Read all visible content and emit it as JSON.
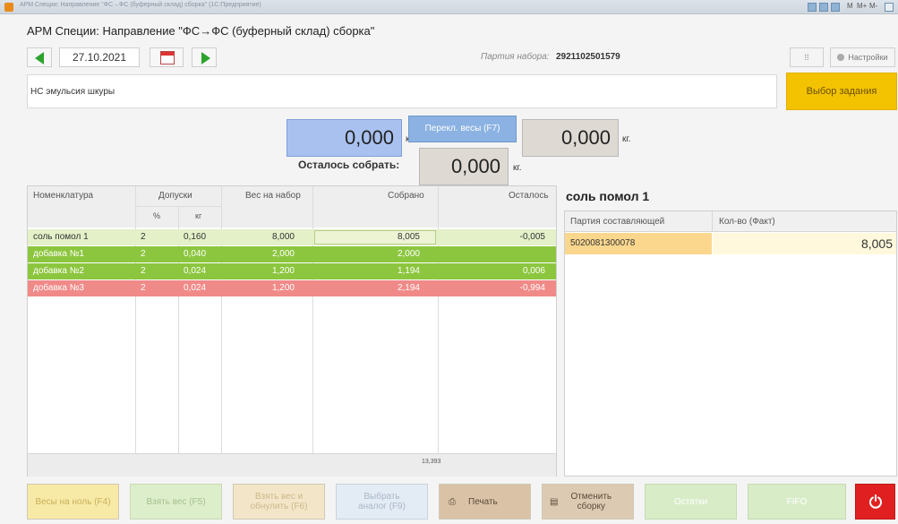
{
  "window": {
    "title_bar_text": "АРМ Специи: Направление \"ФС→ФС (буферный склад) сборка\" (1С:Предприятие)"
  },
  "page_title": "АРМ Специи: Направление \"ФС→ФС (буферный склад) сборка\"",
  "toolbar": {
    "date": "27.10.2021",
    "party_label": "Партия набора:",
    "party_value": "2921102501579",
    "settings_label": "Настройки"
  },
  "task": {
    "current": "НС эмульсия шкуры",
    "select_button": "Выбор задания"
  },
  "scales": {
    "left_value": "0,000",
    "left_unit": "кг.",
    "switch_button": "Перекл. весы (F7)",
    "right_value": "0,000",
    "right_unit": "кг.",
    "remaining_label": "Осталось собрать:",
    "remaining_value": "0,000",
    "remaining_unit": "кг."
  },
  "table": {
    "headers": {
      "name": "Номенклатура",
      "tolerance": "Допуски",
      "tol_pct": "%",
      "tol_kg": "кг",
      "target": "Вес на набор",
      "collected": "Собрано",
      "remaining": "Осталось"
    },
    "rows": [
      {
        "name": "соль помол 1",
        "pct": "2",
        "kg": "0,160",
        "target": "8,000",
        "collected": "8,005",
        "remaining": "-0,005",
        "status": "selected"
      },
      {
        "name": "добавка №1",
        "pct": "2",
        "kg": "0,040",
        "target": "2,000",
        "collected": "2,000",
        "remaining": "",
        "status": "ok"
      },
      {
        "name": "добавка №2",
        "pct": "2",
        "kg": "0,024",
        "target": "1,200",
        "collected": "1,194",
        "remaining": "0,006",
        "status": "ok"
      },
      {
        "name": "добавка №3",
        "pct": "2",
        "kg": "0,024",
        "target": "1,200",
        "collected": "2,194",
        "remaining": "-0,994",
        "status": "error"
      }
    ],
    "total_collected": "13,393"
  },
  "component": {
    "title": "соль помол 1",
    "headers": {
      "party": "Партия составляющей",
      "qty": "Кол-во (Факт)"
    },
    "rows": [
      {
        "party": "5020081300078",
        "qty": "8,005"
      }
    ]
  },
  "buttons": {
    "zero_scale": "Весы на ноль (F4)",
    "take_weight": "Взять вес (F5)",
    "take_weight_reset_1": "Взять вес и",
    "take_weight_reset_2": "обнулить (F6)",
    "choose_analog_1": "Выбрать",
    "choose_analog_2": "аналог (F9)",
    "print": "Печать",
    "cancel_assembly_1": "Отменить",
    "cancel_assembly_2": "сборку",
    "leftovers": "Остатки",
    "fifo": "FIFO"
  },
  "colors": {
    "selected_row": "#e3f0c8",
    "ok_row": "#8cc63f",
    "error_row": "#f08a88",
    "accent_yellow": "#f3c200",
    "power_red": "#e02020"
  }
}
